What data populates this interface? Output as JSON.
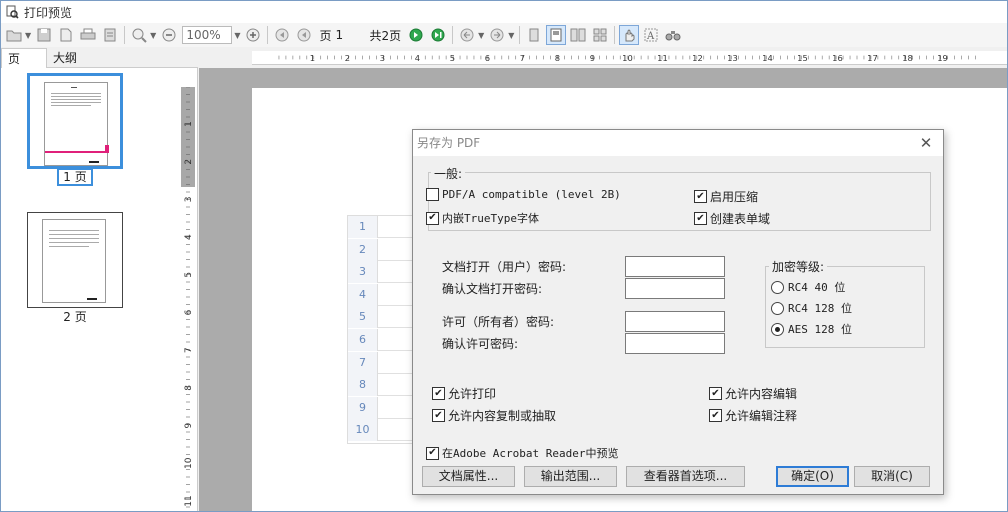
{
  "window": {
    "title": "打印预览"
  },
  "toolbar": {
    "zoom": "100%",
    "page_label": "页",
    "page_value": "1",
    "total_pages": "共2页"
  },
  "tabs": [
    {
      "label": "页"
    },
    {
      "label": "大纲"
    }
  ],
  "thumbnails": [
    {
      "caption": "1 页"
    },
    {
      "caption": "2 页"
    }
  ],
  "ruler": {
    "top": [
      "1",
      "2",
      "3",
      "4",
      "5",
      "6",
      "7",
      "8",
      "9",
      "10",
      "11",
      "12",
      "13",
      "14",
      "15",
      "16",
      "17",
      "18",
      "19"
    ],
    "left": [
      "1",
      "2",
      "3",
      "4",
      "5",
      "6",
      "7",
      "8",
      "9",
      "10",
      "11"
    ]
  },
  "sheet": {
    "row_numbers": [
      "1",
      "2",
      "3",
      "4",
      "5",
      "6",
      "7",
      "8",
      "9",
      "10"
    ]
  },
  "dialog": {
    "title": "另存为 PDF",
    "general_label": "一般:",
    "general": {
      "pdfa": {
        "label": "PDF/A compatible (level 2B)",
        "checked": false
      },
      "embed_truetype": {
        "label": "内嵌TrueType字体",
        "checked": true
      },
      "compression": {
        "label": "启用压缩",
        "checked": true
      },
      "create_form": {
        "label": "创建表单域",
        "checked": true
      }
    },
    "fields": {
      "open_password": "文档打开（用户）密码:",
      "confirm_open_password": "确认文档打开密码:",
      "owner_password": "许可（所有者）密码:",
      "confirm_owner_password": "确认许可密码:"
    },
    "encryption": {
      "label": "加密等级:",
      "options": [
        {
          "label": "RC4 40 位",
          "selected": false
        },
        {
          "label": "RC4 128 位",
          "selected": false
        },
        {
          "label": "AES 128 位",
          "selected": true
        }
      ]
    },
    "permissions": {
      "allow_print": "允许打印",
      "allow_copy": "允许内容复制或抽取",
      "allow_edit": "允许内容编辑",
      "allow_annot": "允许编辑注释",
      "preview_acrobat": "在Adobe Acrobat Reader中预览"
    },
    "buttons": {
      "doc_props": "文档属性...",
      "output_range": "输出范围...",
      "viewer_prefs": "查看器首选项...",
      "ok": "确定(O)",
      "cancel": "取消(C)"
    }
  }
}
